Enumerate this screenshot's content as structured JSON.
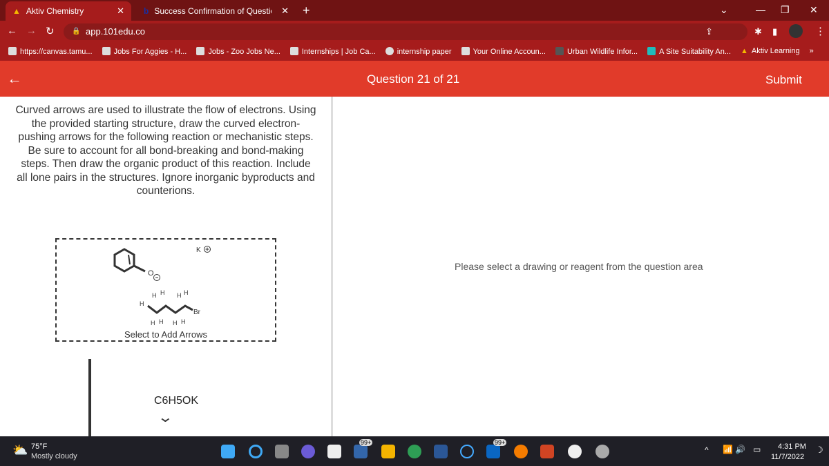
{
  "browser": {
    "tabs": [
      {
        "title": "Aktiv Chemistry"
      },
      {
        "title": "Success Confirmation of Questio"
      }
    ],
    "url": "app.101edu.co",
    "bookmarks": [
      "https://canvas.tamu...",
      "Jobs For Aggies - H...",
      "Jobs - Zoo Jobs Ne...",
      "Internships | Job Ca...",
      "internship paper",
      "Your Online Accoun...",
      "Urban Wildlife Infor...",
      "A Site Suitability An...",
      "Aktiv Learning"
    ]
  },
  "header": {
    "question": "Question 21 of 21",
    "submit": "Submit"
  },
  "question": {
    "prompt": "Curved arrows are used to illustrate the flow of electrons. Using the provided starting structure, draw the curved electron-pushing arrows for the following reaction or mechanistic steps. Be sure to account for all bond-breaking and bond-making steps. Then draw the organic product of this reaction. Include all lone pairs in the structures. Ignore inorganic byproducts and counterions.",
    "drawing_label": "Select to Add Arrows",
    "cation": "K",
    "bromine": "Br",
    "oxygen": "O",
    "reagent": "C6H5OK"
  },
  "right": {
    "message": "Please select a drawing or reagent from the question area"
  },
  "taskbar": {
    "temp": "75°F",
    "weather": "Mostly cloudy",
    "time": "4:31 PM",
    "date": "11/7/2022",
    "badge1": "99+",
    "badge2": "99+"
  },
  "colors": {
    "header": "#e13b2a",
    "browser": "#a61c1c"
  }
}
